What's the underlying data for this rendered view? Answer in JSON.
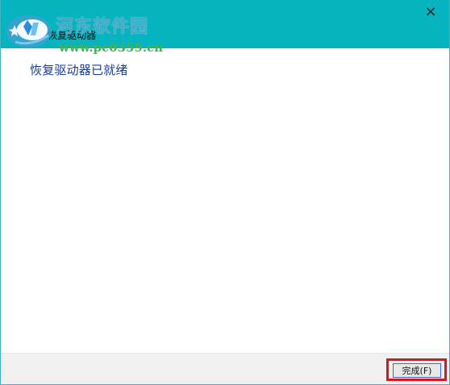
{
  "window": {
    "title": "恢复驱动器",
    "close_glyph": "×"
  },
  "watermark": {
    "site_name": "河东软件园",
    "site_url": "www.pc0359.cn"
  },
  "main": {
    "status_heading": "恢复驱动器已就绪"
  },
  "footer": {
    "finish_label": "完成(F)"
  },
  "icons": {
    "back": "back-arrow-icon",
    "close": "close-icon",
    "logo": "watermark-logo-icon"
  },
  "colors": {
    "titlebar": "#06b4c0",
    "heading": "#1e3d8f",
    "footer": "#f0f0f0",
    "highlight": "#e0121d",
    "button_border": "#2f6ae3"
  }
}
